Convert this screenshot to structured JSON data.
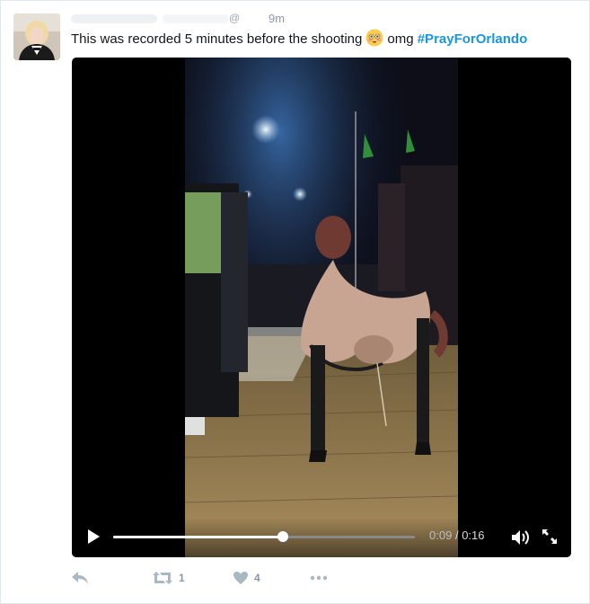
{
  "tweet": {
    "time": "9m",
    "text_before_emoji": "This was recorded 5 minutes before the shooting",
    "emoji": "flushed-face-emoji",
    "text_after_emoji": "omg",
    "hashtag": "#PrayForOrlando",
    "hashtag_color": "#1b95e0"
  },
  "video": {
    "current_time": "0:09",
    "separator": "/",
    "duration": "0:16",
    "progress_fraction": 0.5625,
    "play_icon": "play-icon",
    "volume_icon": "volume-icon",
    "fullscreen_icon": "fullscreen-icon"
  },
  "actions": {
    "reply_icon": "reply-icon",
    "retweet_icon": "retweet-icon",
    "retweet_count": "1",
    "like_icon": "heart-icon",
    "like_count": "4",
    "more_icon": "more-icon",
    "icon_color": "#aab8c2"
  }
}
